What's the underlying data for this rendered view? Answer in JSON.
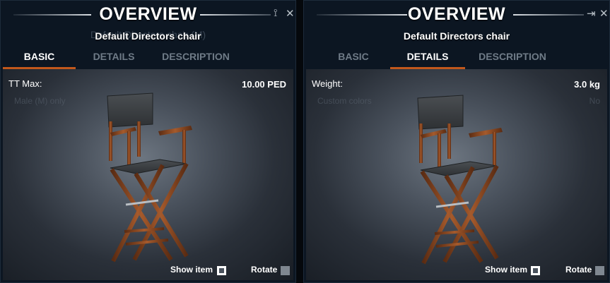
{
  "left_panel": {
    "title": "OVERVIEW",
    "pin_icon": "pin-icon",
    "close_icon": "close-icon",
    "ghost_text": "Default Directors chair (M)",
    "item_name": "Default Directors chair",
    "tabs": [
      "BASIC",
      "DETAILS",
      "DESCRIPTION"
    ],
    "active_tab": "BASIC",
    "stat_label": "TT Max:",
    "stat_value": "10.00 PED",
    "faded_label": "Male (M) only",
    "show_item_label": "Show item",
    "rotate_label": "Rotate"
  },
  "right_panel": {
    "title": "OVERVIEW",
    "pin_icon": "pin-icon",
    "close_icon": "close-icon",
    "item_name": "Default Directors chair",
    "tabs": [
      "BASIC",
      "DETAILS",
      "DESCRIPTION"
    ],
    "active_tab": "DETAILS",
    "stat_label": "Weight:",
    "stat_value": "3.0 kg",
    "faded_label": "Custom colors",
    "faded_value": "No",
    "show_item_label": "Show item",
    "rotate_label": "Rotate"
  },
  "colors": {
    "accent": "#c2581c",
    "panel_bg": "#0c1622",
    "tab_inactive": "#6f7b87",
    "wood": "#8a4a24",
    "canvas": "#3f4347"
  }
}
